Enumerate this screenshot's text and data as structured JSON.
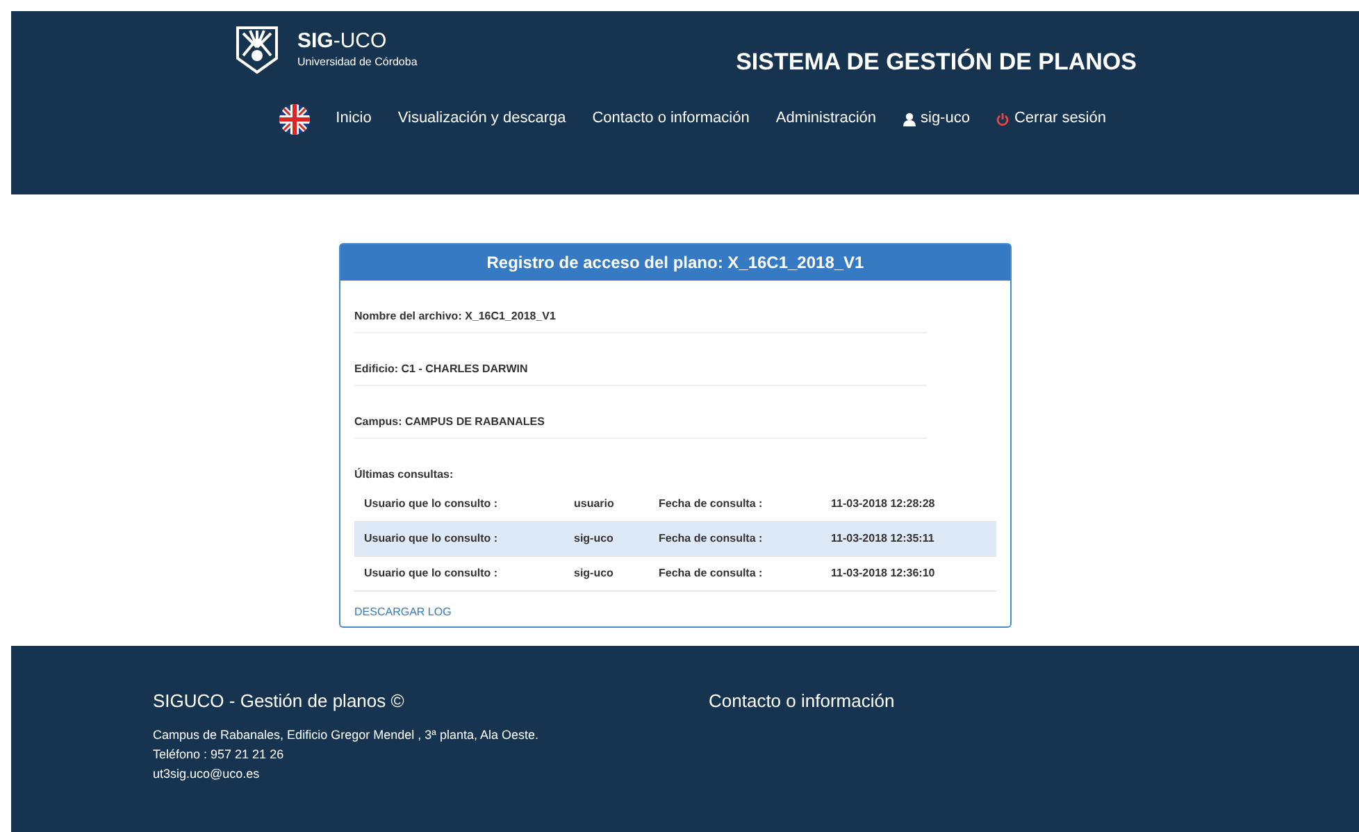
{
  "brand": {
    "title_bold": "SIG",
    "title_rest": "-UCO",
    "subtitle": "Universidad de Córdoba"
  },
  "header_title": "SISTEMA DE GESTIÓN DE PLANOS",
  "nav": [
    {
      "kind": "flag"
    },
    {
      "kind": "link",
      "label": "Inicio"
    },
    {
      "kind": "link",
      "label": "Visualización y descarga"
    },
    {
      "kind": "link",
      "label": "Contacto o información"
    },
    {
      "kind": "link",
      "label": "Administración"
    },
    {
      "kind": "user",
      "label": "sig-uco"
    },
    {
      "kind": "logout",
      "label": "Cerrar sesión"
    }
  ],
  "panel": {
    "title": "Registro de acceso del plano: X_16C1_2018_V1",
    "fields": [
      "Nombre del archivo: X_16C1_2018_V1",
      "Edificio: C1 - CHARLES DARWIN",
      "Campus: CAMPUS DE RABANALES"
    ],
    "consultas_label": "Últimas consultas:",
    "rows": [
      {
        "user_label": "Usuario que lo consulto :",
        "user": "usuario",
        "date_label": "Fecha de consulta :",
        "date": "11-03-2018 12:28:28",
        "selected": false
      },
      {
        "user_label": "Usuario que lo consulto :",
        "user": "sig-uco",
        "date_label": "Fecha de consulta :",
        "date": "11-03-2018 12:35:11",
        "selected": true
      },
      {
        "user_label": "Usuario que lo consulto :",
        "user": "sig-uco",
        "date_label": "Fecha de consulta :",
        "date": "11-03-2018 12:36:10",
        "selected": false
      }
    ],
    "download_link": "DESCARGAR LOG"
  },
  "footer": {
    "title": "SIGUCO - Gestión de planos ©",
    "lines": [
      "Campus de Rabanales, Edificio Gregor Mendel , 3ª planta, Ala Oeste.",
      "Teléfono : 957 21 21 26",
      "ut3sig.uco@uco.es"
    ],
    "contact_title": "Contacto o información"
  }
}
